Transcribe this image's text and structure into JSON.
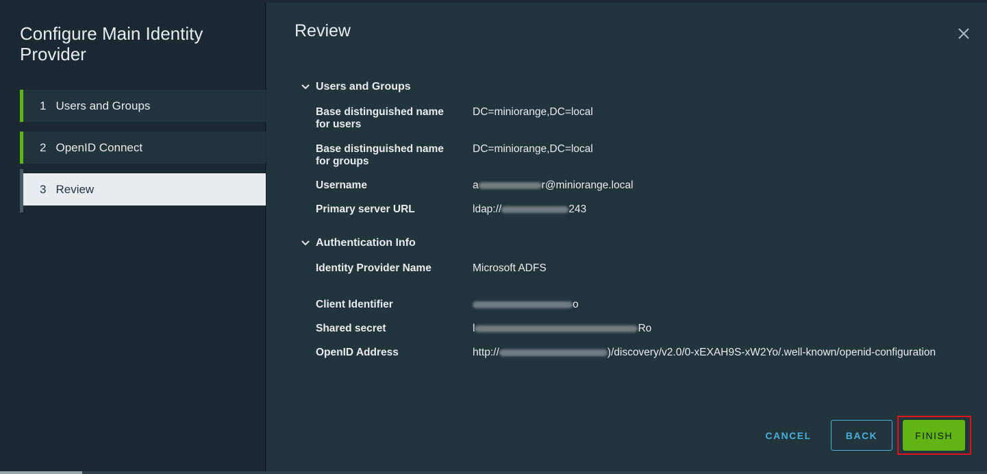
{
  "wizard": {
    "title": "Configure Main Identity Provider",
    "steps": [
      {
        "num": "1",
        "label": "Users and Groups"
      },
      {
        "num": "2",
        "label": "OpenID Connect"
      },
      {
        "num": "3",
        "label": "Review"
      }
    ]
  },
  "review": {
    "title": "Review",
    "sections": {
      "users_groups": {
        "title": "Users and Groups",
        "base_dn_users_label": "Base distinguished name for users",
        "base_dn_users_value": "DC=miniorange,DC=local",
        "base_dn_groups_label": "Base distinguished name for groups",
        "base_dn_groups_value": "DC=miniorange,DC=local",
        "username_label": "Username",
        "username_prefix": "a",
        "username_suffix": "r@miniorange.local",
        "primary_url_label": "Primary server URL",
        "primary_url_prefix": "ldap://",
        "primary_url_suffix": "243"
      },
      "auth_info": {
        "title": "Authentication Info",
        "idp_name_label": "Identity Provider Name",
        "idp_name_value": "Microsoft ADFS",
        "client_id_label": "Client Identifier",
        "client_id_suffix": "o",
        "shared_secret_label": "Shared secret",
        "shared_secret_prefix": "l",
        "shared_secret_suffix": "Ro",
        "openid_label": "OpenID Address",
        "openid_prefix": "http://",
        "openid_suffix": ")/discovery/v2.0/0-xEXAH9S-xW2Yo/.well-known/openid-configuration"
      }
    }
  },
  "buttons": {
    "cancel": "CANCEL",
    "back": "BACK",
    "finish": "FINISH"
  },
  "colors": {
    "accent_green": "#60b515",
    "link_blue": "#49afd9",
    "highlight_red": "#e3141b"
  }
}
